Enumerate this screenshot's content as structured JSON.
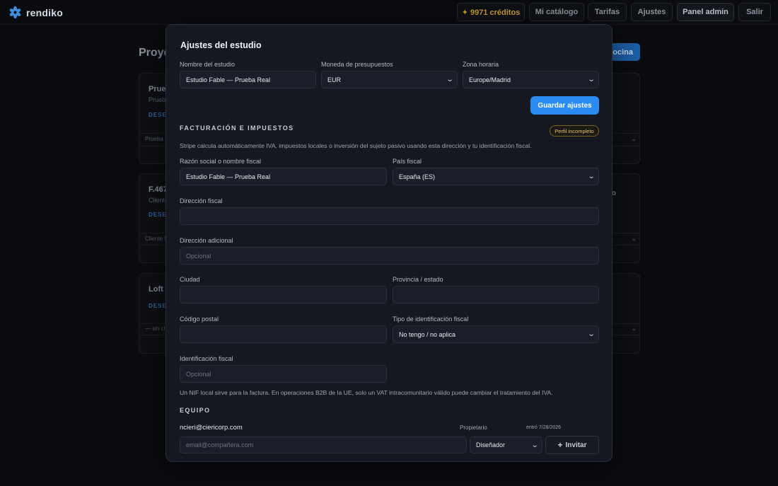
{
  "app": {
    "name": "rendiko",
    "brand_color": "#2a8bf2"
  },
  "nav": {
    "credits": "✦ 9971 créditos",
    "catalog": "Mi catálogo",
    "rates": "Tarifas",
    "settings": "Ajustes",
    "admin": "Panel admin",
    "logout": "Salir"
  },
  "background": {
    "page_title": "Proye",
    "new_button": "ocina",
    "cards": [
      {
        "title": "Prueb",
        "subtitle": "Prueb",
        "tag": "DESE",
        "select": "Prueba",
        "right": ""
      },
      {
        "title": "F.467",
        "subtitle": "Cliente",
        "tag": "DESE",
        "select": "Cliente I",
        "right": "o"
      },
      {
        "title": "Loft I",
        "subtitle": "",
        "tag": "DESE",
        "select": "— sin cl",
        "right": ""
      }
    ]
  },
  "modal": {
    "title": "Ajustes del estudio",
    "studio_name": {
      "label": "Nombre del estudio",
      "value": "Estudio Fable — Prueba Real"
    },
    "currency": {
      "label": "Moneda de presupuestos",
      "value": "EUR"
    },
    "timezone": {
      "label": "Zona horaria",
      "value": "Europe/Madrid"
    },
    "save_button": "Guardar ajustes",
    "billing": {
      "heading": "FACTURACIÓN E IMPUESTOS",
      "badge": "Perfil incompleto",
      "description": "Stripe calcula automáticamente IVA, impuestos locales o inversión del sujeto pasivo usando esta dirección y tu identificación fiscal.",
      "legal_name": {
        "label": "Razón social o nombre fiscal",
        "value": "Estudio Fable — Prueba Real"
      },
      "country": {
        "label": "País fiscal",
        "value": "España (ES)"
      },
      "address": {
        "label": "Dirección fiscal",
        "value": ""
      },
      "address2": {
        "label": "Dirección adicional",
        "placeholder": "Opcional"
      },
      "city": {
        "label": "Ciudad",
        "value": ""
      },
      "province": {
        "label": "Provincia / estado",
        "value": ""
      },
      "postal_code": {
        "label": "Código postal",
        "value": ""
      },
      "tax_id_type": {
        "label": "Tipo de identificación fiscal",
        "value": "No tengo / no aplica"
      },
      "tax_id": {
        "label": "Identificación fiscal",
        "placeholder": "Opcional"
      },
      "note": "Un NIF local sirve para la factura. En operaciones B2B de la UE, solo un VAT intracomunitario válido puede cambiar el tratamiento del IVA."
    },
    "team": {
      "heading": "EQUIPO",
      "members": [
        {
          "email": "ncieri@ciericorp.com",
          "role": "Propietario",
          "joined": "entró 7/28/2026"
        }
      ],
      "invite_placeholder": "email@compañera.com",
      "invite_role": "Diseñador",
      "invite_button": "Invitar"
    }
  }
}
